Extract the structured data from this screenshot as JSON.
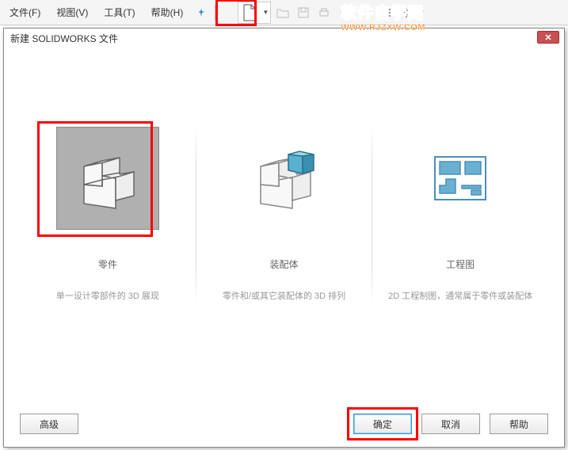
{
  "toolbar": {
    "menus": {
      "file": "文件(F)",
      "view": "视图(V)",
      "tools": "工具(T)",
      "help": "帮助(H)"
    }
  },
  "watermark": {
    "line1": "软件自学网",
    "line2": "WWW.RJZXW.COM"
  },
  "dialog": {
    "title": "新建 SOLIDWORKS 文件",
    "options": {
      "part": {
        "title": "零件",
        "desc": "单一设计零部件的 3D 展现"
      },
      "assembly": {
        "title": "装配体",
        "desc": "零件和/或其它装配体的 3D 排列"
      },
      "drawing": {
        "title": "工程图",
        "desc": "2D 工程制图，通常属于零件或装配体"
      }
    },
    "buttons": {
      "advanced": "高级",
      "ok": "确定",
      "cancel": "取消",
      "help": "帮助"
    }
  }
}
